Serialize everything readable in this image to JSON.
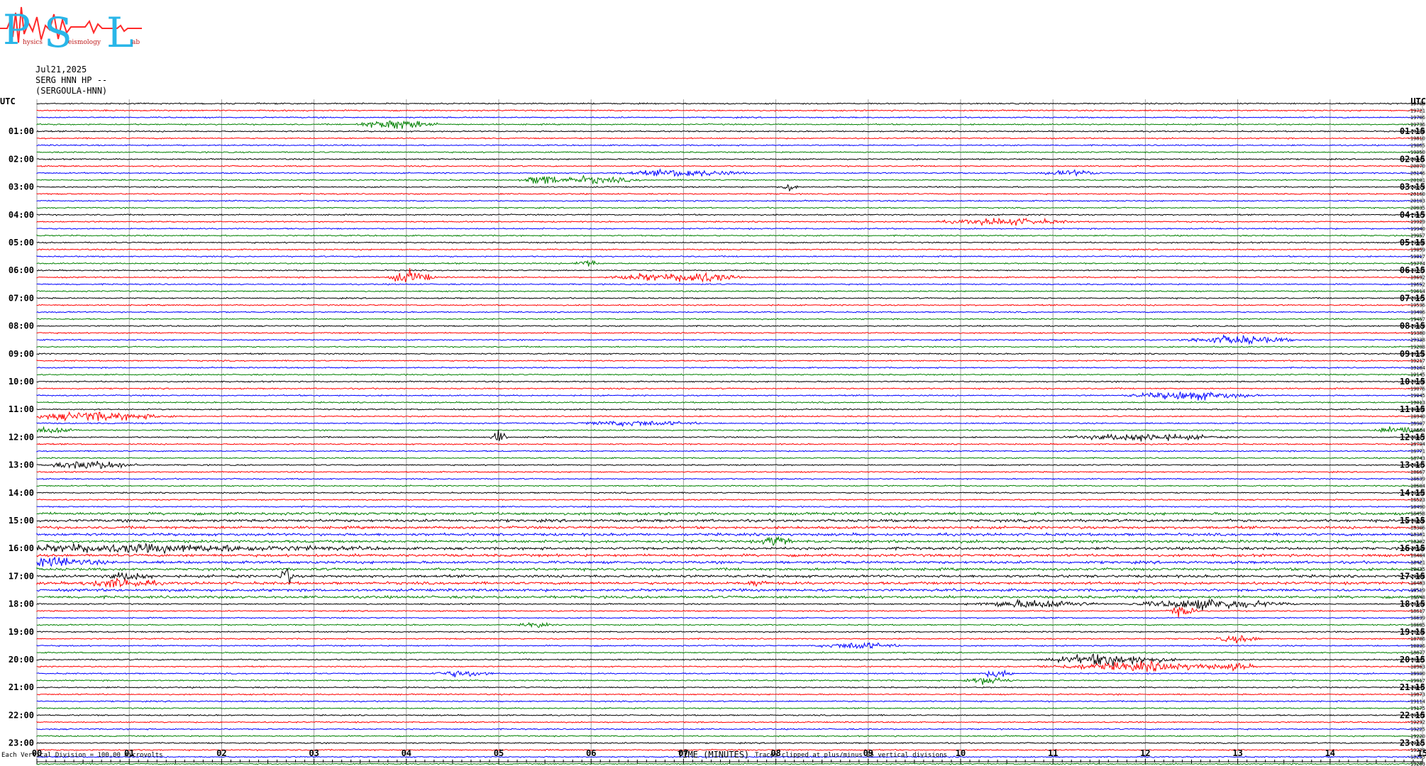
{
  "logo": {
    "letters": [
      "P",
      "S",
      "L"
    ],
    "words": [
      "hysics",
      "eismology",
      "ab"
    ],
    "colors": {
      "letters": "#29b6e8",
      "wave": "#ff2a2a"
    }
  },
  "header": {
    "date": "Jul21,2025",
    "station": "SERG HNN HP --",
    "name": "(SERGOULA-HNN)"
  },
  "chart_data": {
    "type": "line",
    "title": "",
    "xlabel": "TIME (MINUTES)",
    "x_ticks": [
      "00",
      "01",
      "02",
      "03",
      "04",
      "05",
      "06",
      "07",
      "08",
      "09",
      "10",
      "11",
      "12",
      "13",
      "14",
      "15"
    ],
    "xlim": [
      0,
      15
    ],
    "left_label_top": "UTC",
    "right_label_top": "UTC",
    "left_hour_labels": [
      "01:00",
      "02:00",
      "03:00",
      "04:00",
      "05:00",
      "06:00",
      "07:00",
      "08:00",
      "09:00",
      "10:00",
      "11:00",
      "12:00",
      "13:00",
      "14:00",
      "15:00",
      "16:00",
      "17:00",
      "18:00",
      "19:00",
      "20:00",
      "21:00",
      "22:00",
      "23:00"
    ],
    "right_hour_labels": [
      "01:15",
      "02:15",
      "03:15",
      "04:15",
      "05:15",
      "06:15",
      "07:15",
      "08:15",
      "09:15",
      "10:15",
      "11:15",
      "12:15",
      "13:15",
      "14:15",
      "15:15",
      "16:15",
      "17:15",
      "18:15",
      "19:15",
      "20:15",
      "21:15",
      "22:15",
      "23:15"
    ],
    "trace_colors": [
      "#000000",
      "#ff0000",
      "#0000ff",
      "#008000"
    ],
    "trace_count": 96,
    "right_values": [
      "-19708",
      "-19721",
      "-19706",
      "-19736",
      "-19758",
      "-19810",
      "-19865",
      "-19950",
      "-20011",
      "-20070",
      "-20146",
      "-20101",
      "-20174",
      "-20160",
      "-20103",
      "-20035",
      "-19979",
      "-19929",
      "-19940",
      "-19957",
      "-19908",
      "-19859",
      "-19817",
      "-19774",
      "-19733",
      "-19692",
      "-19652",
      "-19614",
      "-19575",
      "-19536",
      "-19496",
      "-19457",
      "-19420",
      "-19380",
      "-19338",
      "-19298",
      "-19256",
      "-19217",
      "-19184",
      "-19145",
      "-19108",
      "-19076",
      "-19045",
      "-19013",
      "-18982",
      "-18940",
      "-18907",
      "-18864",
      "-18827",
      "-18794",
      "-18771",
      "-18743",
      "-18695",
      "-18667",
      "-18639",
      "-18604",
      "-18562",
      "-18523",
      "-18490",
      "-18458",
      "-18426",
      "-18306",
      "-18361",
      "-18302",
      "-18390",
      "-18404",
      "-18421",
      "-18435",
      "-18458",
      "-18483",
      "-18519",
      "-18548",
      "-18594",
      "-18617",
      "-18639",
      "-18685",
      "-18736",
      "-18786",
      "-18836",
      "-18877",
      "-18921",
      "-18963",
      "-18990",
      "-19017",
      "-19045",
      "-19073",
      "-19114",
      "-19175",
      "-19212",
      "-19232",
      "-19225",
      "-19220",
      "-19221",
      "-19229",
      "-19255",
      "-19263"
    ],
    "events": [
      {
        "trace": 3,
        "x": 3.9,
        "width": 0.5,
        "amp": 6
      },
      {
        "trace": 10,
        "x": 7.0,
        "width": 0.8,
        "amp": 4
      },
      {
        "trace": 10,
        "x": 11.2,
        "width": 0.4,
        "amp": 3
      },
      {
        "trace": 11,
        "x": 5.5,
        "width": 0.3,
        "amp": 6
      },
      {
        "trace": 11,
        "x": 6.0,
        "width": 0.6,
        "amp": 4
      },
      {
        "trace": 12,
        "x": 8.15,
        "width": 0.1,
        "amp": 7
      },
      {
        "trace": 17,
        "x": 10.5,
        "width": 0.8,
        "amp": 4
      },
      {
        "trace": 23,
        "x": 5.95,
        "width": 0.15,
        "amp": 5
      },
      {
        "trace": 25,
        "x": 4.05,
        "width": 0.3,
        "amp": 8
      },
      {
        "trace": 25,
        "x": 6.6,
        "width": 0.5,
        "amp": 4
      },
      {
        "trace": 25,
        "x": 7.15,
        "width": 0.5,
        "amp": 7
      },
      {
        "trace": 34,
        "x": 13.0,
        "width": 0.7,
        "amp": 5
      },
      {
        "trace": 42,
        "x": 12.5,
        "width": 0.8,
        "amp": 5
      },
      {
        "trace": 45,
        "x": 0.6,
        "width": 1.0,
        "amp": 5
      },
      {
        "trace": 46,
        "x": 6.5,
        "width": 0.8,
        "amp": 3
      },
      {
        "trace": 47,
        "x": 0.1,
        "width": 0.4,
        "amp": 4
      },
      {
        "trace": 47,
        "x": 14.8,
        "width": 0.4,
        "amp": 5
      },
      {
        "trace": 48,
        "x": 5.0,
        "width": 0.1,
        "amp": 8
      },
      {
        "trace": 48,
        "x": 12.0,
        "width": 1.0,
        "amp": 4
      },
      {
        "trace": 52,
        "x": 0.6,
        "width": 0.6,
        "amp": 5
      },
      {
        "trace": 63,
        "x": 8.0,
        "width": 0.2,
        "amp": 6
      },
      {
        "trace": 64,
        "x": 1.0,
        "width": 3.0,
        "amp": 4
      },
      {
        "trace": 66,
        "x": 0.2,
        "width": 0.6,
        "amp": 5
      },
      {
        "trace": 68,
        "x": 2.7,
        "width": 0.08,
        "amp": 14
      },
      {
        "trace": 68,
        "x": 1.0,
        "width": 0.3,
        "amp": 4
      },
      {
        "trace": 69,
        "x": 0.9,
        "width": 0.5,
        "amp": 5
      },
      {
        "trace": 69,
        "x": 7.8,
        "width": 0.1,
        "amp": 6
      },
      {
        "trace": 72,
        "x": 10.8,
        "width": 0.8,
        "amp": 5
      },
      {
        "trace": 72,
        "x": 12.7,
        "width": 1.0,
        "amp": 6
      },
      {
        "trace": 73,
        "x": 12.4,
        "width": 0.2,
        "amp": 6
      },
      {
        "trace": 75,
        "x": 5.4,
        "width": 0.2,
        "amp": 3
      },
      {
        "trace": 77,
        "x": 13.0,
        "width": 0.3,
        "amp": 4
      },
      {
        "trace": 78,
        "x": 8.9,
        "width": 0.5,
        "amp": 4
      },
      {
        "trace": 80,
        "x": 11.6,
        "width": 0.8,
        "amp": 7
      },
      {
        "trace": 81,
        "x": 12.0,
        "width": 1.3,
        "amp": 5
      },
      {
        "trace": 81,
        "x": 13.0,
        "width": 0.2,
        "amp": 5
      },
      {
        "trace": 82,
        "x": 4.6,
        "width": 0.4,
        "amp": 4
      },
      {
        "trace": 82,
        "x": 10.4,
        "width": 0.2,
        "amp": 5
      },
      {
        "trace": 83,
        "x": 10.3,
        "width": 0.3,
        "amp": 5
      }
    ]
  },
  "footer": {
    "left": "Each Vertical Division = 100.00 microvolts",
    "note": "Traces clipped at plus/minus 25 vertical divisions"
  }
}
